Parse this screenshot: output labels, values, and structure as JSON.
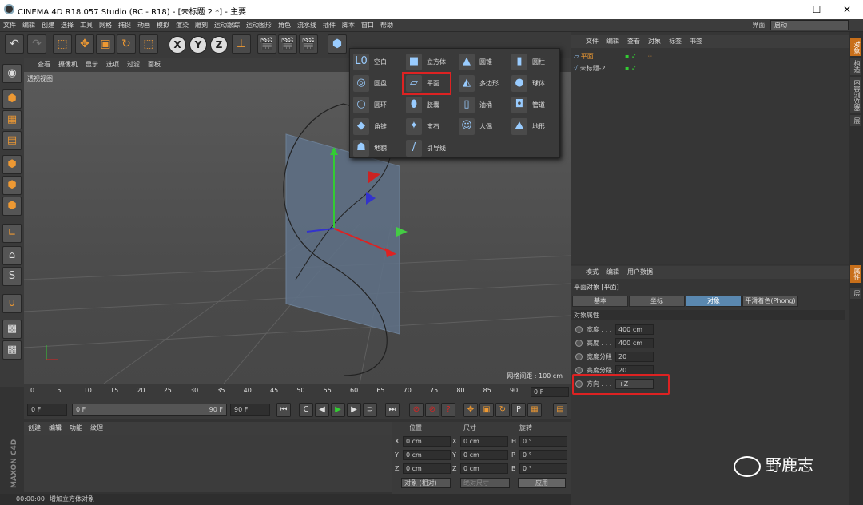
{
  "titlebar": {
    "title": "CINEMA 4D R18.057 Studio (RC - R18) - [未标题 2 *] - 主要",
    "min": "—",
    "max": "☐",
    "close": "✕"
  },
  "menubar": {
    "items": [
      "文件",
      "编辑",
      "创建",
      "选择",
      "工具",
      "网格",
      "捕捉",
      "动画",
      "模拟",
      "渲染",
      "雕刻",
      "运动跟踪",
      "运动图形",
      "角色",
      "流水线",
      "插件",
      "脚本",
      "窗口",
      "帮助"
    ],
    "layout_label": "界面:",
    "layout_value": "启动"
  },
  "viewport": {
    "menu": [
      "查看",
      "摄像机",
      "显示",
      "选项",
      "过滤",
      "面板"
    ],
    "title": "透视视图",
    "grid_label": "网格间距 : 100 cm"
  },
  "popup": {
    "items": [
      {
        "label": "空白",
        "icon": "L0"
      },
      {
        "label": "立方体",
        "icon": "■"
      },
      {
        "label": "圆锥",
        "icon": "▲"
      },
      {
        "label": "圆柱",
        "icon": "▮"
      },
      {
        "label": "圆盘",
        "icon": "◎"
      },
      {
        "label": "平面",
        "icon": "▱"
      },
      {
        "label": "多边形",
        "icon": "◭"
      },
      {
        "label": "球体",
        "icon": "●"
      },
      {
        "label": "圆环",
        "icon": "○"
      },
      {
        "label": "胶囊",
        "icon": "⬮"
      },
      {
        "label": "油桶",
        "icon": "▯"
      },
      {
        "label": "管道",
        "icon": "◘"
      },
      {
        "label": "角锥",
        "icon": "◆"
      },
      {
        "label": "宝石",
        "icon": "✦"
      },
      {
        "label": "人偶",
        "icon": "☺"
      },
      {
        "label": "地形",
        "icon": "⛰"
      },
      {
        "label": "地貌",
        "icon": "☗"
      },
      {
        "label": "引导线",
        "icon": "/"
      }
    ]
  },
  "timeline": {
    "ticks": [
      "0",
      "5",
      "10",
      "15",
      "20",
      "25",
      "30",
      "35",
      "40",
      "45",
      "50",
      "55",
      "60",
      "65",
      "70",
      "75",
      "80",
      "85",
      "90"
    ],
    "frame": "0 F"
  },
  "playbar": {
    "start": "0 F",
    "range_start": "0 F",
    "range_end": "90 F",
    "end": "90 F"
  },
  "material": {
    "menu": [
      "创建",
      "编辑",
      "功能",
      "纹理"
    ]
  },
  "coord": {
    "headers": [
      "位置",
      "尺寸",
      "旋转"
    ],
    "rows": [
      {
        "a": "X",
        "av": "0 cm",
        "b": "X",
        "bv": "0 cm",
        "c": "H",
        "cv": "0 °"
      },
      {
        "a": "Y",
        "av": "0 cm",
        "b": "Y",
        "bv": "0 cm",
        "c": "P",
        "cv": "0 °"
      },
      {
        "a": "Z",
        "av": "0 cm",
        "b": "Z",
        "bv": "0 cm",
        "c": "B",
        "cv": "0 °"
      }
    ],
    "mode": "对象 (相对)",
    "size_mode": "绝对尺寸",
    "apply": "应用"
  },
  "status": {
    "time": "00:00:00",
    "text": "增加立方体对象"
  },
  "objects": {
    "menu": [
      "文件",
      "编辑",
      "查看",
      "对象",
      "标签",
      "书签"
    ],
    "items": [
      {
        "name": "平面"
      },
      {
        "name": "未标题-2"
      }
    ]
  },
  "attributes": {
    "menu": [
      "模式",
      "编辑",
      "用户数据"
    ],
    "title": "平面对象 [平面]",
    "tabs": [
      "基本",
      "坐标",
      "对象",
      "平滑着色(Phong)"
    ],
    "section": "对象属性",
    "rows": [
      {
        "label": "宽度 . . .",
        "value": "400 cm"
      },
      {
        "label": "高度 . . .",
        "value": "400 cm"
      },
      {
        "label": "宽度分段",
        "value": "20"
      },
      {
        "label": "高度分段",
        "value": "20"
      },
      {
        "label": "方向 . . .",
        "value": "+Z"
      }
    ]
  },
  "sidetabs": [
    "对象",
    "构造",
    "内容浏览器",
    "层",
    "属性",
    "层"
  ],
  "watermark": "野鹿志",
  "colors": {
    "accent": "#c86f1a",
    "highlight": "#dd2222",
    "selected_tab": "#5a88b0"
  }
}
